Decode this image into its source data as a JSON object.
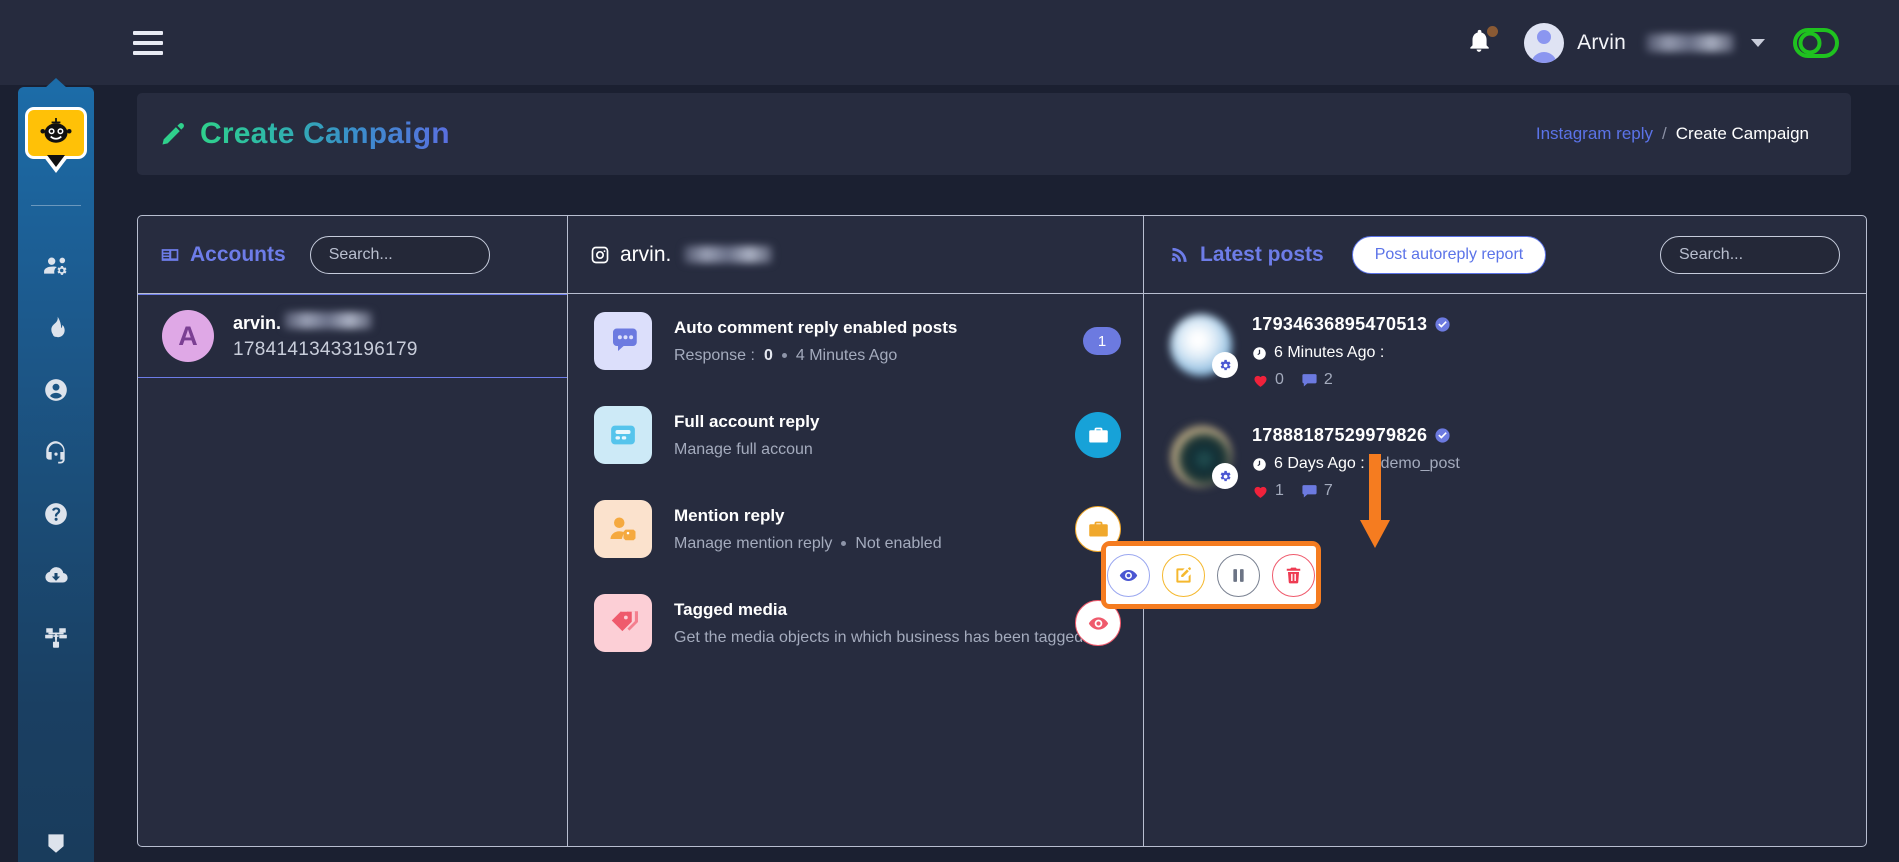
{
  "topbar": {
    "menu_icon": "hamburger-icon",
    "bell_icon": "bell-icon",
    "user_name": "Arvin",
    "toggle_icon": "toggle-on-icon"
  },
  "sidebar": {
    "logo_icon": "chatbot-logo-icon",
    "items": [
      {
        "icon": "users-cog-icon",
        "name": "sidebar-item-users"
      },
      {
        "icon": "fire-icon",
        "name": "sidebar-item-trending"
      },
      {
        "icon": "user-circle-icon",
        "name": "sidebar-item-profile"
      },
      {
        "icon": "headset-icon",
        "name": "sidebar-item-support"
      },
      {
        "icon": "question-circle-icon",
        "name": "sidebar-item-help"
      },
      {
        "icon": "cloud-download-icon",
        "name": "sidebar-item-downloads"
      },
      {
        "icon": "sitemap-icon",
        "name": "sidebar-item-sitemap"
      }
    ],
    "bottom_icon": "chevron-down-icon"
  },
  "page_header": {
    "pen_icon": "pen-icon",
    "title": "Create Campaign",
    "breadcrumb": {
      "parent": "Instagram reply",
      "separator": "/",
      "current": "Create Campaign"
    }
  },
  "accounts_panel": {
    "title": "Accounts",
    "title_icon": "id-card-icon",
    "search_placeholder": "Search...",
    "search_value": "",
    "rows": [
      {
        "initial": "A",
        "name": "arvin.",
        "id": "17841413433196179"
      }
    ]
  },
  "middle_panel": {
    "account_icon": "instagram-icon",
    "account_name": "arvin.",
    "items": [
      {
        "icon": "comment-dots-icon",
        "title": "Auto comment reply enabled posts",
        "sub_label": "Response :",
        "sub_value": "0",
        "sub_time": "4 Minutes Ago",
        "badge": "1",
        "badge_type": "pill"
      },
      {
        "icon": "id-badge-icon",
        "title": "Full account reply",
        "sub_label": "Manage full accoun",
        "sub_value": "",
        "sub_time": "",
        "badge": "briefcase-icon",
        "badge_type": "circle-blue"
      },
      {
        "icon": "user-tag-icon",
        "title": "Mention reply",
        "sub_label": "Manage mention reply",
        "sub_value": "",
        "sub_time": "Not enabled",
        "badge": "briefcase-icon",
        "badge_type": "circle-yellow"
      },
      {
        "icon": "tags-icon",
        "title": "Tagged media",
        "sub_label": "Get the media objects in which business has been tagged.",
        "sub_value": "",
        "sub_time": "",
        "badge": "eye-icon",
        "badge_type": "circle-red"
      }
    ],
    "action_popup": {
      "buttons": [
        {
          "icon": "eye-icon",
          "name": "view-action-button",
          "color": "#4a56d2"
        },
        {
          "icon": "edit-icon",
          "name": "edit-action-button",
          "color": "#f5b82e"
        },
        {
          "icon": "pause-icon",
          "name": "pause-action-button",
          "color": "#6c7485"
        },
        {
          "icon": "trash-icon",
          "name": "delete-action-button",
          "color": "#ee3b52"
        }
      ],
      "highlight_color": "#f57c20"
    }
  },
  "posts_panel": {
    "title": "Latest posts",
    "title_icon": "rss-icon",
    "report_button": "Post autoreply report",
    "search_placeholder": "Search...",
    "search_value": "",
    "posts": [
      {
        "id": "17934636895470513",
        "verified": true,
        "time": "6 Minutes Ago :",
        "tag": "",
        "likes": "0",
        "comments": "2"
      },
      {
        "id": "17888187529979826",
        "verified": true,
        "time": "6 Days Ago :",
        "tag": "#demo_post",
        "likes": "1",
        "comments": "7"
      }
    ]
  }
}
